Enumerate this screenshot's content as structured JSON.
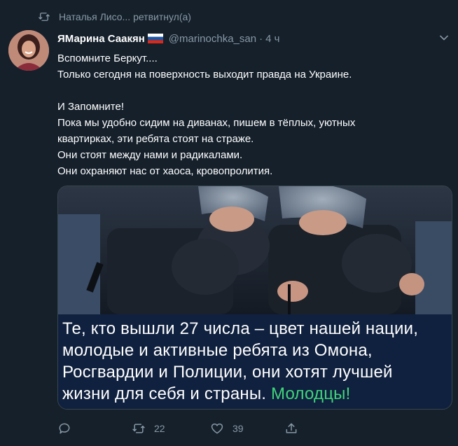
{
  "retweet": {
    "text": "Наталья Лисо... ретвитнул(а)",
    "icon": "retweet-icon"
  },
  "author": {
    "name": "ЯМарина Саакян",
    "handle": "@marinochka_san",
    "separator": "·",
    "time": "4 ч",
    "flag": "russian-flag-icon"
  },
  "tweet": {
    "lines": [
      "Вспомните Беркут....",
      "Только сегодня на поверхность выходит правда на Украине.",
      "И Запомните!",
      "Пока мы удобно сидим на диванах, пишем в тёплых, уютных",
      "квартирках, эти ребята стоят на страже.",
      "Они стоят между нами и радикалами.",
      "Они охраняют нас от хаоса, кровопролития."
    ]
  },
  "media": {
    "caption_lines": [
      "Те, кто вышли 27 числа – цвет нашей нации,",
      "молодые и активные ребята из Омона,",
      "Росгвардии и Полиции, они хотят лучшей",
      "жизни для себя и страны."
    ],
    "caption_highlight": "Молодцы!",
    "highlight_color": "#3fd47a"
  },
  "actions": {
    "reply_count": "",
    "retweet_count": "22",
    "like_count": "39"
  },
  "colors": {
    "background": "#15202b",
    "secondary_text": "#8899a6",
    "accent": "#1da1f2"
  }
}
